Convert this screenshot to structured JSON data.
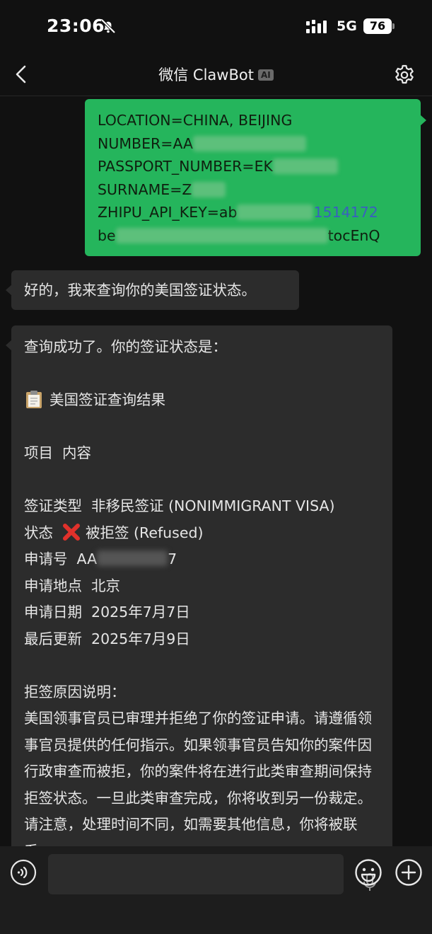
{
  "status_bar": {
    "time": "23:06",
    "network": "5G",
    "battery": "76"
  },
  "nav": {
    "title": "微信 ClawBot",
    "badge": "AI"
  },
  "messages": {
    "user": {
      "lines": [
        {
          "text": "LOCATION=CHINA, BEIJING"
        },
        {
          "text": "NUMBER=AA"
        },
        {
          "text": "PASSPORT_NUMBER=EK"
        },
        {
          "text": "SURNAME=Z"
        },
        {
          "text": "ZHIPU_API_KEY=ab",
          "tail": "1514172"
        },
        {
          "text": "be",
          "tail": "tocEnQ"
        }
      ]
    },
    "bot1": {
      "text": "好的，我来查询你的美国签证状态。"
    },
    "bot2": {
      "intro": "查询成功了。你的签证状态是：",
      "heading": "美国签证查询结果",
      "table_header": {
        "col1": "项目",
        "col2": "内容"
      },
      "rows": {
        "visa_type": {
          "label": "签证类型",
          "value": "非移民签证 (NONIMMIGRANT VISA)"
        },
        "status": {
          "label": "状态",
          "value": "被拒签 (Refused)"
        },
        "app_no": {
          "label": "申请号",
          "value_start": "AA",
          "value_end": "7"
        },
        "location": {
          "label": "申请地点",
          "value": "北京"
        },
        "date": {
          "label": "申请日期",
          "value": "2025年7月7日"
        },
        "updated": {
          "label": "最后更新",
          "value": "2025年7月9日"
        }
      },
      "reason_title": "拒签原因说明：",
      "reason_text": "美国领事官员已审理并拒绝了你的签证申请。请遵循领事官员提供的任何指示。如果领事官员告知你的案件因行政审查而被拒，你的案件将在进行此类审查期间保持拒签状态。一旦此类审查完成，你将收到另一份裁定。请注意，处理时间不同，如需要其他信息，你将被联系。"
    }
  },
  "icons": {
    "clipboard": "clipboard-icon",
    "cross": "cross-mark-icon",
    "accent_green": "#25b55c",
    "cross_red": "#e0312b"
  }
}
